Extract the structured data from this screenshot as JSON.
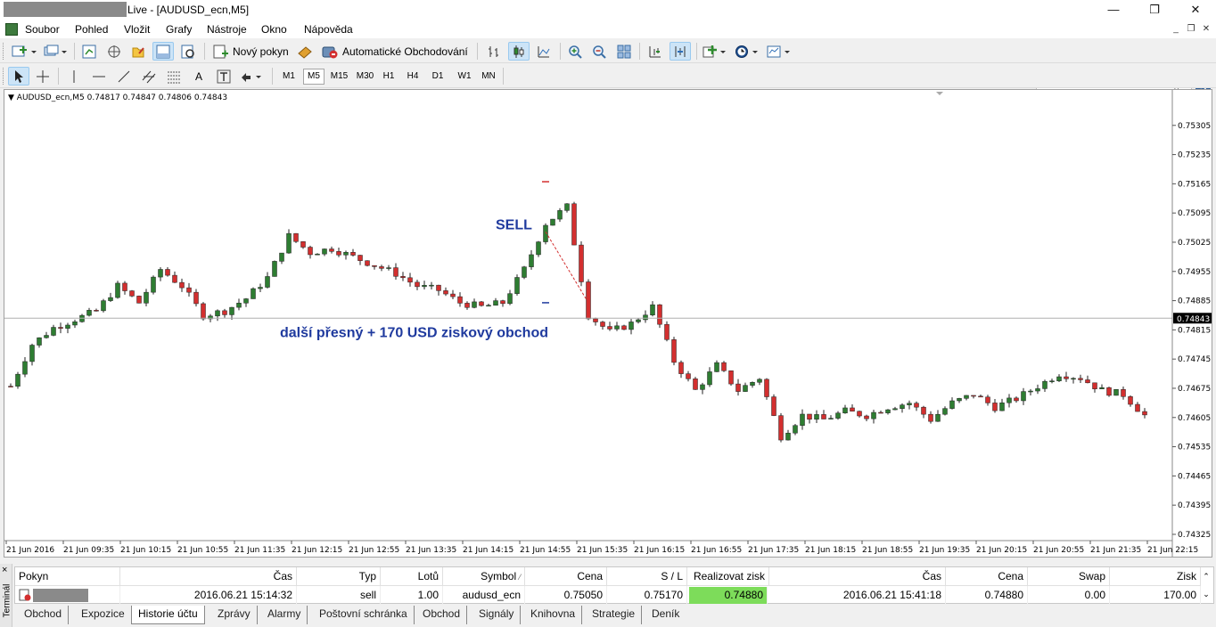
{
  "window": {
    "title": "Live - [AUDUSD_ecn,M5]",
    "controls": {
      "minimize": "—",
      "restore": "❐",
      "close": "✕"
    }
  },
  "menu": {
    "items": [
      "Soubor",
      "Pohled",
      "Vložit",
      "Grafy",
      "Nástroje",
      "Okno",
      "Nápověda"
    ],
    "mdi": {
      "minimize": "_",
      "restore": "❐",
      "close": "✕"
    }
  },
  "toolbar": {
    "new_order": "Nový pokyn",
    "autotrading": "Automatické Obchodování",
    "timeframes": [
      "M1",
      "M5",
      "M15",
      "M30",
      "H1",
      "H4",
      "D1",
      "W1",
      "MN"
    ],
    "active_timeframe": "M5",
    "search_placeholder": ""
  },
  "chart": {
    "header": "AUDUSD_ecn,M5  0.74817 0.74847 0.74806 0.74843",
    "current_price_label": "0.74843",
    "annotation_sell": "SELL",
    "annotation_profit": "další přesný + 170 USD ziskový obchod",
    "colors": {
      "bull": "#2e7d32",
      "bear": "#d32f2f",
      "annotation": "#1f3a9e",
      "price_line": "#b0b0b0"
    }
  },
  "chart_data": {
    "type": "candlestick",
    "symbol": "AUDUSD_ecn",
    "timeframe": "M5",
    "y_ticks": [
      "0.75305",
      "0.75235",
      "0.75165",
      "0.75095",
      "0.75025",
      "0.74955",
      "0.74885",
      "0.74815",
      "0.74745",
      "0.74675",
      "0.74605",
      "0.74535",
      "0.74465",
      "0.74395",
      "0.74325"
    ],
    "ylim": [
      0.7431,
      0.7536
    ],
    "x_ticks": [
      "21 Jun 2016",
      "21 Jun 09:35",
      "21 Jun 10:15",
      "21 Jun 10:55",
      "21 Jun 11:35",
      "21 Jun 12:15",
      "21 Jun 12:55",
      "21 Jun 13:35",
      "21 Jun 14:15",
      "21 Jun 14:55",
      "21 Jun 15:35",
      "21 Jun 16:15",
      "21 Jun 16:55",
      "21 Jun 17:35",
      "21 Jun 18:15",
      "21 Jun 18:55",
      "21 Jun 19:35",
      "21 Jun 20:15",
      "21 Jun 20:55",
      "21 Jun 21:35",
      "21 Jun 22:15"
    ],
    "current_price": 0.74843,
    "trade": {
      "open_price": 0.7505,
      "close_price": 0.7488,
      "stop_loss": 0.7517,
      "take_profit": 0.7488
    },
    "close_path": [
      0.7468,
      0.7478,
      0.7482,
      0.7484,
      0.7486,
      0.7492,
      0.7488,
      0.7496,
      0.7492,
      0.7485,
      0.7486,
      0.7489,
      0.7494,
      0.7504,
      0.75,
      0.7501,
      0.7499,
      0.7497,
      0.7495,
      0.7492,
      0.7491,
      0.7488,
      0.7487,
      0.7488,
      0.7496,
      0.7507,
      0.7511,
      0.7485,
      0.7481,
      0.7483,
      0.7487,
      0.7474,
      0.7467,
      0.7473,
      0.7467,
      0.747,
      0.7456,
      0.7461,
      0.746,
      0.7462,
      0.7461,
      0.7463,
      0.7464,
      0.746,
      0.7464,
      0.7466,
      0.7463,
      0.7465,
      0.7468,
      0.7471,
      0.747,
      0.7467,
      0.7466,
      0.7461
    ]
  },
  "terminal": {
    "side_label": "Terminál",
    "close": "×",
    "columns": [
      "Pokyn",
      "Čas",
      "Typ",
      "Lotů",
      "Symbol",
      "Cena",
      "S / L",
      "Realizovat zisk",
      "Čas",
      "Cena",
      "Swap",
      "Zisk"
    ],
    "row": {
      "time": "2016.06.21 15:14:32",
      "type": "sell",
      "lots": "1.00",
      "symbol": "audusd_ecn",
      "price": "0.75050",
      "sl": "0.75170",
      "tp": "0.74880",
      "close_time": "2016.06.21 15:41:18",
      "close_price": "0.74880",
      "swap": "0.00",
      "profit": "170.00"
    },
    "tabs": [
      "Obchod",
      "Expozice",
      "Historie účtu",
      "Zprávy",
      "Alarmy",
      "Poštovní schránka",
      "Obchod",
      "Signály",
      "Knihovna",
      "Strategie",
      "Deník"
    ],
    "active_tab": "Historie účtu"
  }
}
